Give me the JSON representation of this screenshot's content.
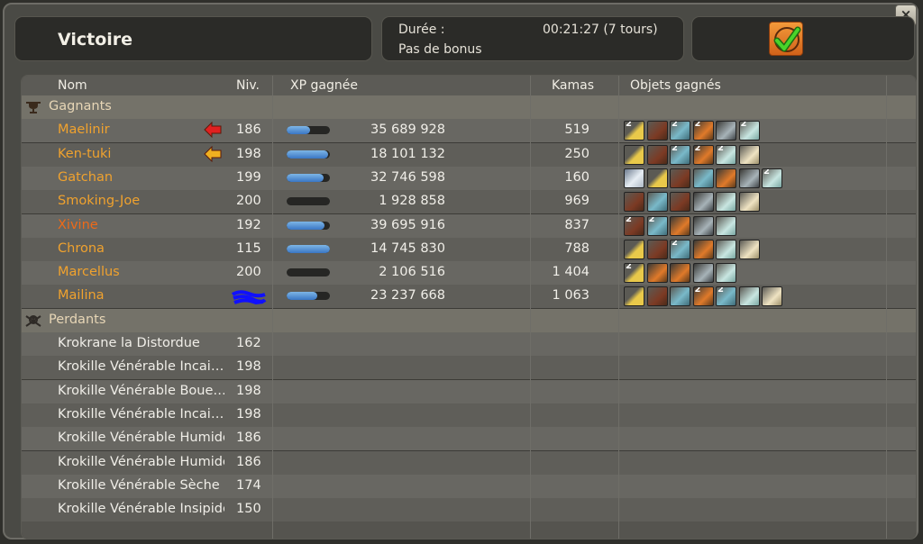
{
  "header": {
    "title": "Victoire",
    "duration_label": "Durée :",
    "duration_value": "00:21:27 (7 tours)",
    "bonus_label": "Pas de bonus"
  },
  "columns": {
    "name": "Nom",
    "level": "Niv.",
    "xp": "XP gagnée",
    "kamas": "Kamas",
    "items": "Objets gagnés"
  },
  "winners_label": "Gagnants",
  "losers_label": "Perdants",
  "winners": [
    {
      "name": "Maelinir",
      "level": "186",
      "xp": "35 689 928",
      "kamas": "519",
      "xp_progress": 0.55,
      "arrow": "red",
      "color": "#f0a22e",
      "items": [
        {
          "type": "wing",
          "qty": "2"
        },
        {
          "type": "meat",
          "qty": ""
        },
        {
          "type": "blue",
          "qty": "2"
        },
        {
          "type": "orange",
          "qty": "2"
        },
        {
          "type": "gray",
          "qty": ""
        },
        {
          "type": "ghost",
          "qty": "2"
        }
      ]
    },
    {
      "name": "Ken-tuki",
      "level": "198",
      "xp": "18 101 132",
      "kamas": "250",
      "xp_progress": 0.95,
      "arrow": "orange",
      "color": "#f0a22e",
      "items": [
        {
          "type": "wing",
          "qty": ""
        },
        {
          "type": "meat",
          "qty": ""
        },
        {
          "type": "blue",
          "qty": "2"
        },
        {
          "type": "orange",
          "qty": "2"
        },
        {
          "type": "ghost",
          "qty": "2"
        },
        {
          "type": "paper",
          "qty": ""
        }
      ]
    },
    {
      "name": "Gatchan",
      "level": "199",
      "xp": "32 746 598",
      "kamas": "160",
      "xp_progress": 0.85,
      "arrow": "",
      "color": "#f0a22e",
      "items": [
        {
          "type": "scroll",
          "qty": ""
        },
        {
          "type": "wing",
          "qty": ""
        },
        {
          "type": "meat",
          "qty": ""
        },
        {
          "type": "blue",
          "qty": ""
        },
        {
          "type": "orange",
          "qty": ""
        },
        {
          "type": "gray",
          "qty": ""
        },
        {
          "type": "ghost",
          "qty": "2"
        }
      ]
    },
    {
      "name": "Smoking-Joe",
      "level": "200",
      "xp": "1 928 858",
      "kamas": "969",
      "xp_progress": 0.0,
      "arrow": "",
      "color": "#f0a22e",
      "items": [
        {
          "type": "meat",
          "qty": ""
        },
        {
          "type": "blue",
          "qty": ""
        },
        {
          "type": "meat",
          "qty": ""
        },
        {
          "type": "gray",
          "qty": ""
        },
        {
          "type": "ghost",
          "qty": ""
        },
        {
          "type": "paper",
          "qty": ""
        }
      ]
    },
    {
      "name": "Xivine",
      "level": "192",
      "xp": "39 695 916",
      "kamas": "837",
      "xp_progress": 0.88,
      "arrow": "",
      "color": "#ee6a18",
      "items": [
        {
          "type": "meat",
          "qty": "2"
        },
        {
          "type": "blue",
          "qty": "2"
        },
        {
          "type": "orange",
          "qty": ""
        },
        {
          "type": "gray",
          "qty": ""
        },
        {
          "type": "ghost",
          "qty": ""
        }
      ]
    },
    {
      "name": "Chrona",
      "level": "115",
      "xp": "14 745 830",
      "kamas": "788",
      "xp_progress": 1.0,
      "arrow": "",
      "color": "#f0a22e",
      "items": [
        {
          "type": "wing",
          "qty": ""
        },
        {
          "type": "meat",
          "qty": ""
        },
        {
          "type": "blue",
          "qty": "2"
        },
        {
          "type": "orange",
          "qty": ""
        },
        {
          "type": "ghost",
          "qty": ""
        },
        {
          "type": "paper",
          "qty": ""
        }
      ]
    },
    {
      "name": "Marcellus",
      "level": "200",
      "xp": "2 106 516",
      "kamas": "1 404",
      "xp_progress": 0.0,
      "arrow": "",
      "color": "#f0a22e",
      "items": [
        {
          "type": "wing",
          "qty": "2"
        },
        {
          "type": "orange",
          "qty": ""
        },
        {
          "type": "orange",
          "qty": ""
        },
        {
          "type": "gray",
          "qty": ""
        },
        {
          "type": "ghost",
          "qty": ""
        }
      ]
    },
    {
      "name": "Mailina",
      "level": "",
      "xp": "23 237 668",
      "kamas": "1 063",
      "xp_progress": 0.7,
      "arrow": "",
      "color": "#f0a22e",
      "items": [
        {
          "type": "wing",
          "qty": ""
        },
        {
          "type": "meat",
          "qty": ""
        },
        {
          "type": "blue",
          "qty": ""
        },
        {
          "type": "orange",
          "qty": "2"
        },
        {
          "type": "blue",
          "qty": "2"
        },
        {
          "type": "ghost",
          "qty": ""
        },
        {
          "type": "paper",
          "qty": ""
        }
      ]
    }
  ],
  "losers": [
    {
      "name": "Krokrane la Distordue",
      "level": "162"
    },
    {
      "name": "Krokille Vénérable Incai…",
      "level": "198"
    },
    {
      "name": "Krokille Vénérable Boue…",
      "level": "198"
    },
    {
      "name": "Krokille Vénérable Incai…",
      "level": "198"
    },
    {
      "name": "Krokille Vénérable Humide",
      "level": "186"
    },
    {
      "name": "Krokille Vénérable Humide",
      "level": "186"
    },
    {
      "name": "Krokille Vénérable Sèche",
      "level": "174"
    },
    {
      "name": "Krokille Vénérable Insipide",
      "level": "150"
    }
  ],
  "colors": {
    "winner_name": "#f0a22e",
    "highlight_name": "#ee6a18",
    "accent_ok": "#e07a2a"
  },
  "icons": {
    "close": "close-icon",
    "confirm": "checkmark-icon",
    "winners": "trophy-icon",
    "losers": "skull-icon"
  }
}
